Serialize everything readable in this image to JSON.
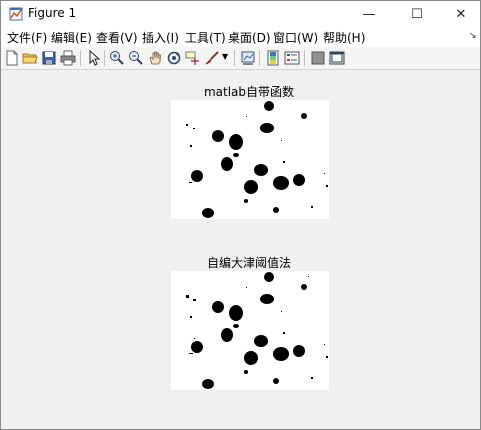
{
  "window": {
    "title": "Figure 1",
    "min_glyph": "—",
    "max_glyph": "☐",
    "close_glyph": "✕"
  },
  "menu": [
    {
      "label": "文件(F)"
    },
    {
      "label": "编辑(E)"
    },
    {
      "label": "查看(V)"
    },
    {
      "label": "插入(I)"
    },
    {
      "label": "工具(T)"
    },
    {
      "label": "桌面(D)"
    },
    {
      "label": "窗口(W)"
    },
    {
      "label": "帮助(H)"
    }
  ],
  "toolbar": {
    "icons": [
      "new-file-icon",
      "open-folder-icon",
      "save-icon",
      "print-icon",
      "pointer-icon",
      "zoom-in-icon",
      "zoom-out-icon",
      "pan-icon",
      "rotate-3d-icon",
      "data-cursor-icon",
      "brush-icon",
      "brush-dropdown-icon",
      "link-plot-icon",
      "colorbar-icon",
      "legend-icon",
      "hide-plot-tools-icon",
      "show-plot-tools-icon"
    ]
  },
  "axes": [
    {
      "title": "matlab自带函数"
    },
    {
      "title": "自编大津阈值法"
    }
  ]
}
